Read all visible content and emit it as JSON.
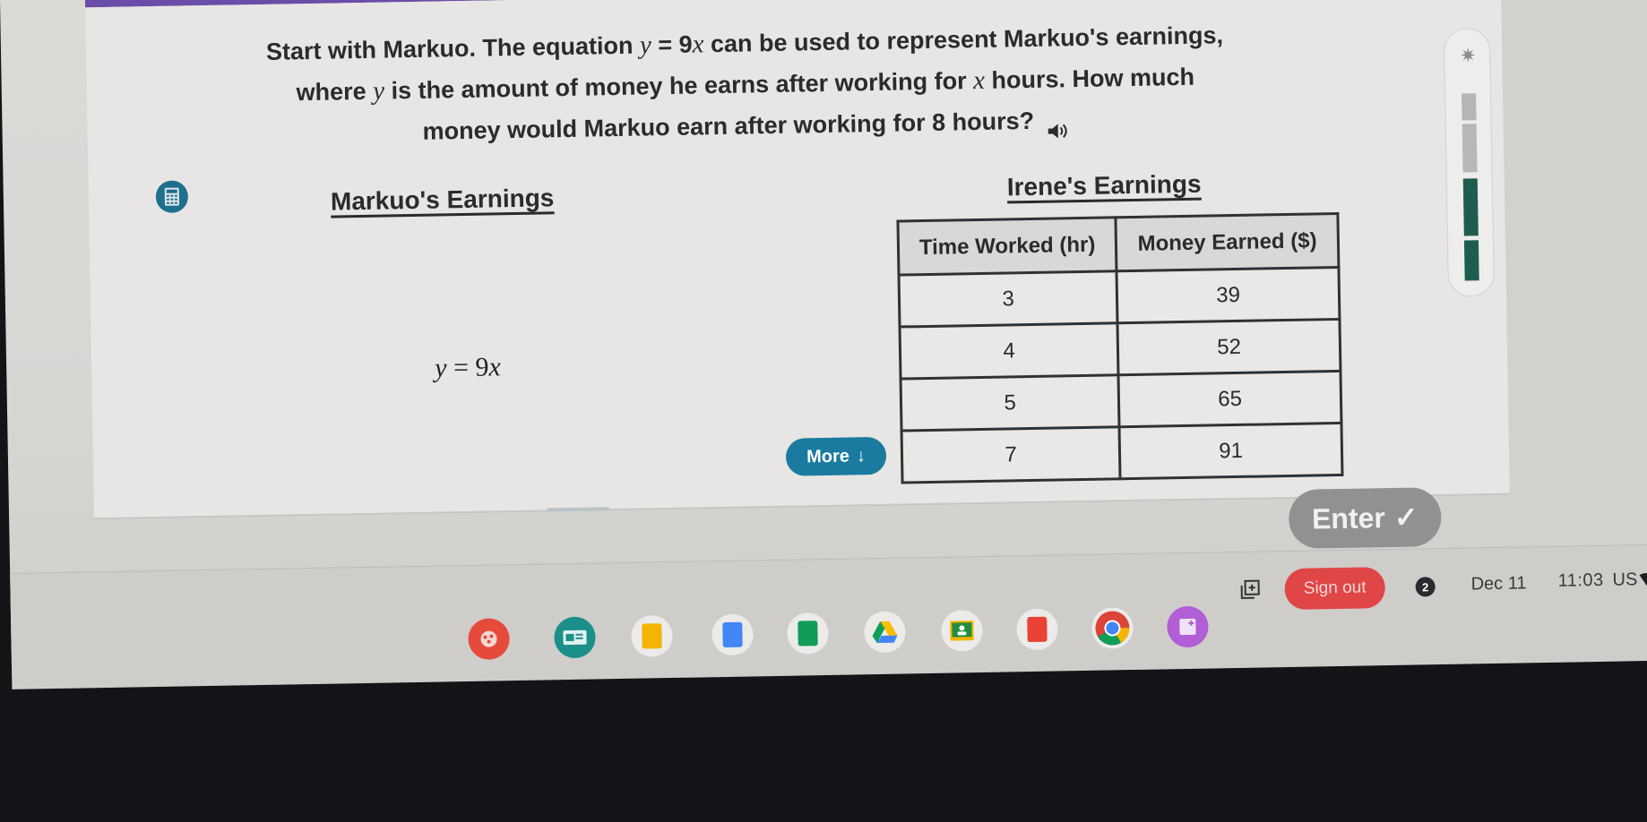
{
  "question": {
    "line1_pre": "Start with Markuo. The equation ",
    "line1_eq_var": "y",
    "line1_eq_rest": " = 9",
    "line1_eq_x": "x",
    "line1_post": " can be used to represent Markuo's earnings,",
    "line2_pre": "where ",
    "line2_var": "y",
    "line2_mid": " is the amount of money he earns after working for ",
    "line2_x": "x",
    "line2_post": " hours. How much",
    "line3": "money would Markuo earn after working for 8 hours?",
    "speaker_icon": "speaker-icon"
  },
  "markuo": {
    "title": "Markuo's Earnings",
    "equation_var": "y",
    "equation_mid": " = 9",
    "equation_x": "x"
  },
  "irene": {
    "title": "Irene's Earnings",
    "table": {
      "headers": [
        "Time Worked (hr)",
        "Money Earned ($)"
      ],
      "rows": [
        [
          "3",
          "39"
        ],
        [
          "4",
          "52"
        ],
        [
          "5",
          "65"
        ],
        [
          "7",
          "91"
        ]
      ]
    }
  },
  "buttons": {
    "more": "More",
    "more_icon": "↓",
    "enter": "Enter",
    "enter_icon": "✓",
    "calculator_icon": "calculator-icon"
  },
  "progress": {
    "segments_total": 4,
    "segments_completed": 2,
    "accent": "#1e5c50"
  },
  "taskbar": {
    "apps": [
      {
        "name": "mind-map-app",
        "color": "#e64a3b"
      },
      {
        "name": "screencast-app",
        "color": "#1b8f8a"
      },
      {
        "name": "google-slides",
        "color": "#f4b400"
      },
      {
        "name": "google-docs",
        "color": "#4285f4"
      },
      {
        "name": "google-sheets",
        "color": "#0f9d58"
      },
      {
        "name": "google-drive",
        "color": "#fbbc04"
      },
      {
        "name": "google-classroom",
        "color": "#1e8e3e"
      },
      {
        "name": "google-forms-red",
        "color": "#e94235"
      },
      {
        "name": "chrome",
        "color": "#4285f4"
      },
      {
        "name": "canvas-app",
        "color": "#b25ed6"
      }
    ],
    "sign_out": "Sign out",
    "notification_count": "2",
    "date": "Dec 11",
    "time": "11:03",
    "locale": "US"
  },
  "colors": {
    "teal_button": "#1a7aa0",
    "enter_disabled": "#8f9291",
    "sign_out": "#e04646"
  }
}
